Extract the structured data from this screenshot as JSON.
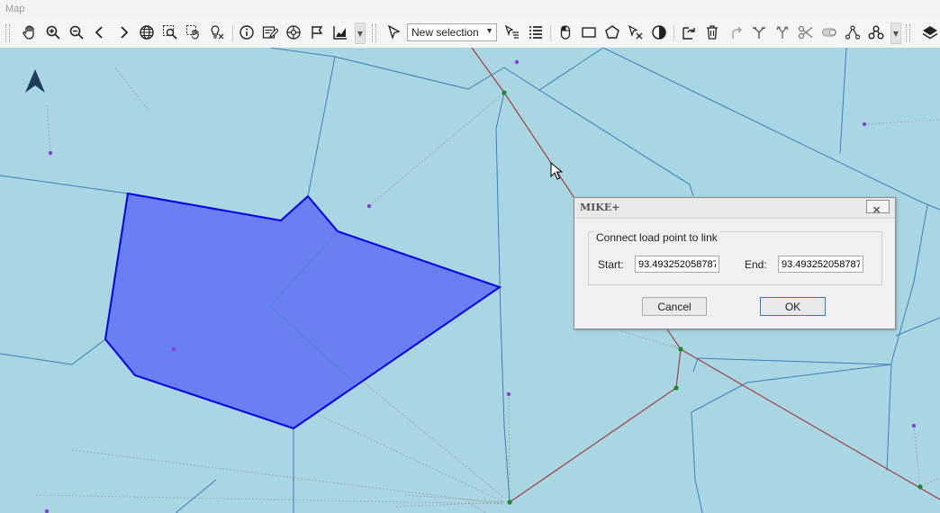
{
  "window": {
    "title": "Map"
  },
  "toolbar": {
    "left_icons": [
      "pan-hand-icon",
      "zoom-in-icon",
      "zoom-out-icon",
      "previous-extent-icon",
      "next-extent-icon",
      "full-extent-globe-icon",
      "zoom-to-selection-icon",
      "pan-to-selection-icon",
      "clear-highlight-icon",
      "identify-info-icon",
      "edit-attributes-icon",
      "network-icon",
      "flag-icon",
      "chart-icon"
    ],
    "selection_mode": "New selection",
    "right_icons": [
      "select-by-attributes-icon",
      "list-icon",
      "mouse-icon",
      "rectangle-select-icon",
      "polygon-select-icon",
      "clear-selection-icon",
      "invert-selection-icon",
      "refresh-icon",
      "delete-icon",
      "undo-icon",
      "merge-icon",
      "split-icon",
      "cut-icon",
      "toggle-icon",
      "connect-nodes-icon",
      "nodes-icon",
      "layers-icon"
    ]
  },
  "dialog": {
    "title": "MIKE+",
    "group_label": "Connect load point to link",
    "start_label": "Start:",
    "start_value": "93.493252058787",
    "end_label": "End:",
    "end_value": "93.493252058787",
    "cancel_label": "Cancel",
    "ok_label": "OK"
  },
  "colors": {
    "map_background": "#a8d6e3",
    "catchment_border": "#3d7fb9",
    "selected_fill": "#6a80f2",
    "selected_border": "#0000e6",
    "link_line": "#a33333",
    "connection_line": "#a0a4a8",
    "node": "#1a8a2a",
    "load_point": "#8a3fd4"
  }
}
